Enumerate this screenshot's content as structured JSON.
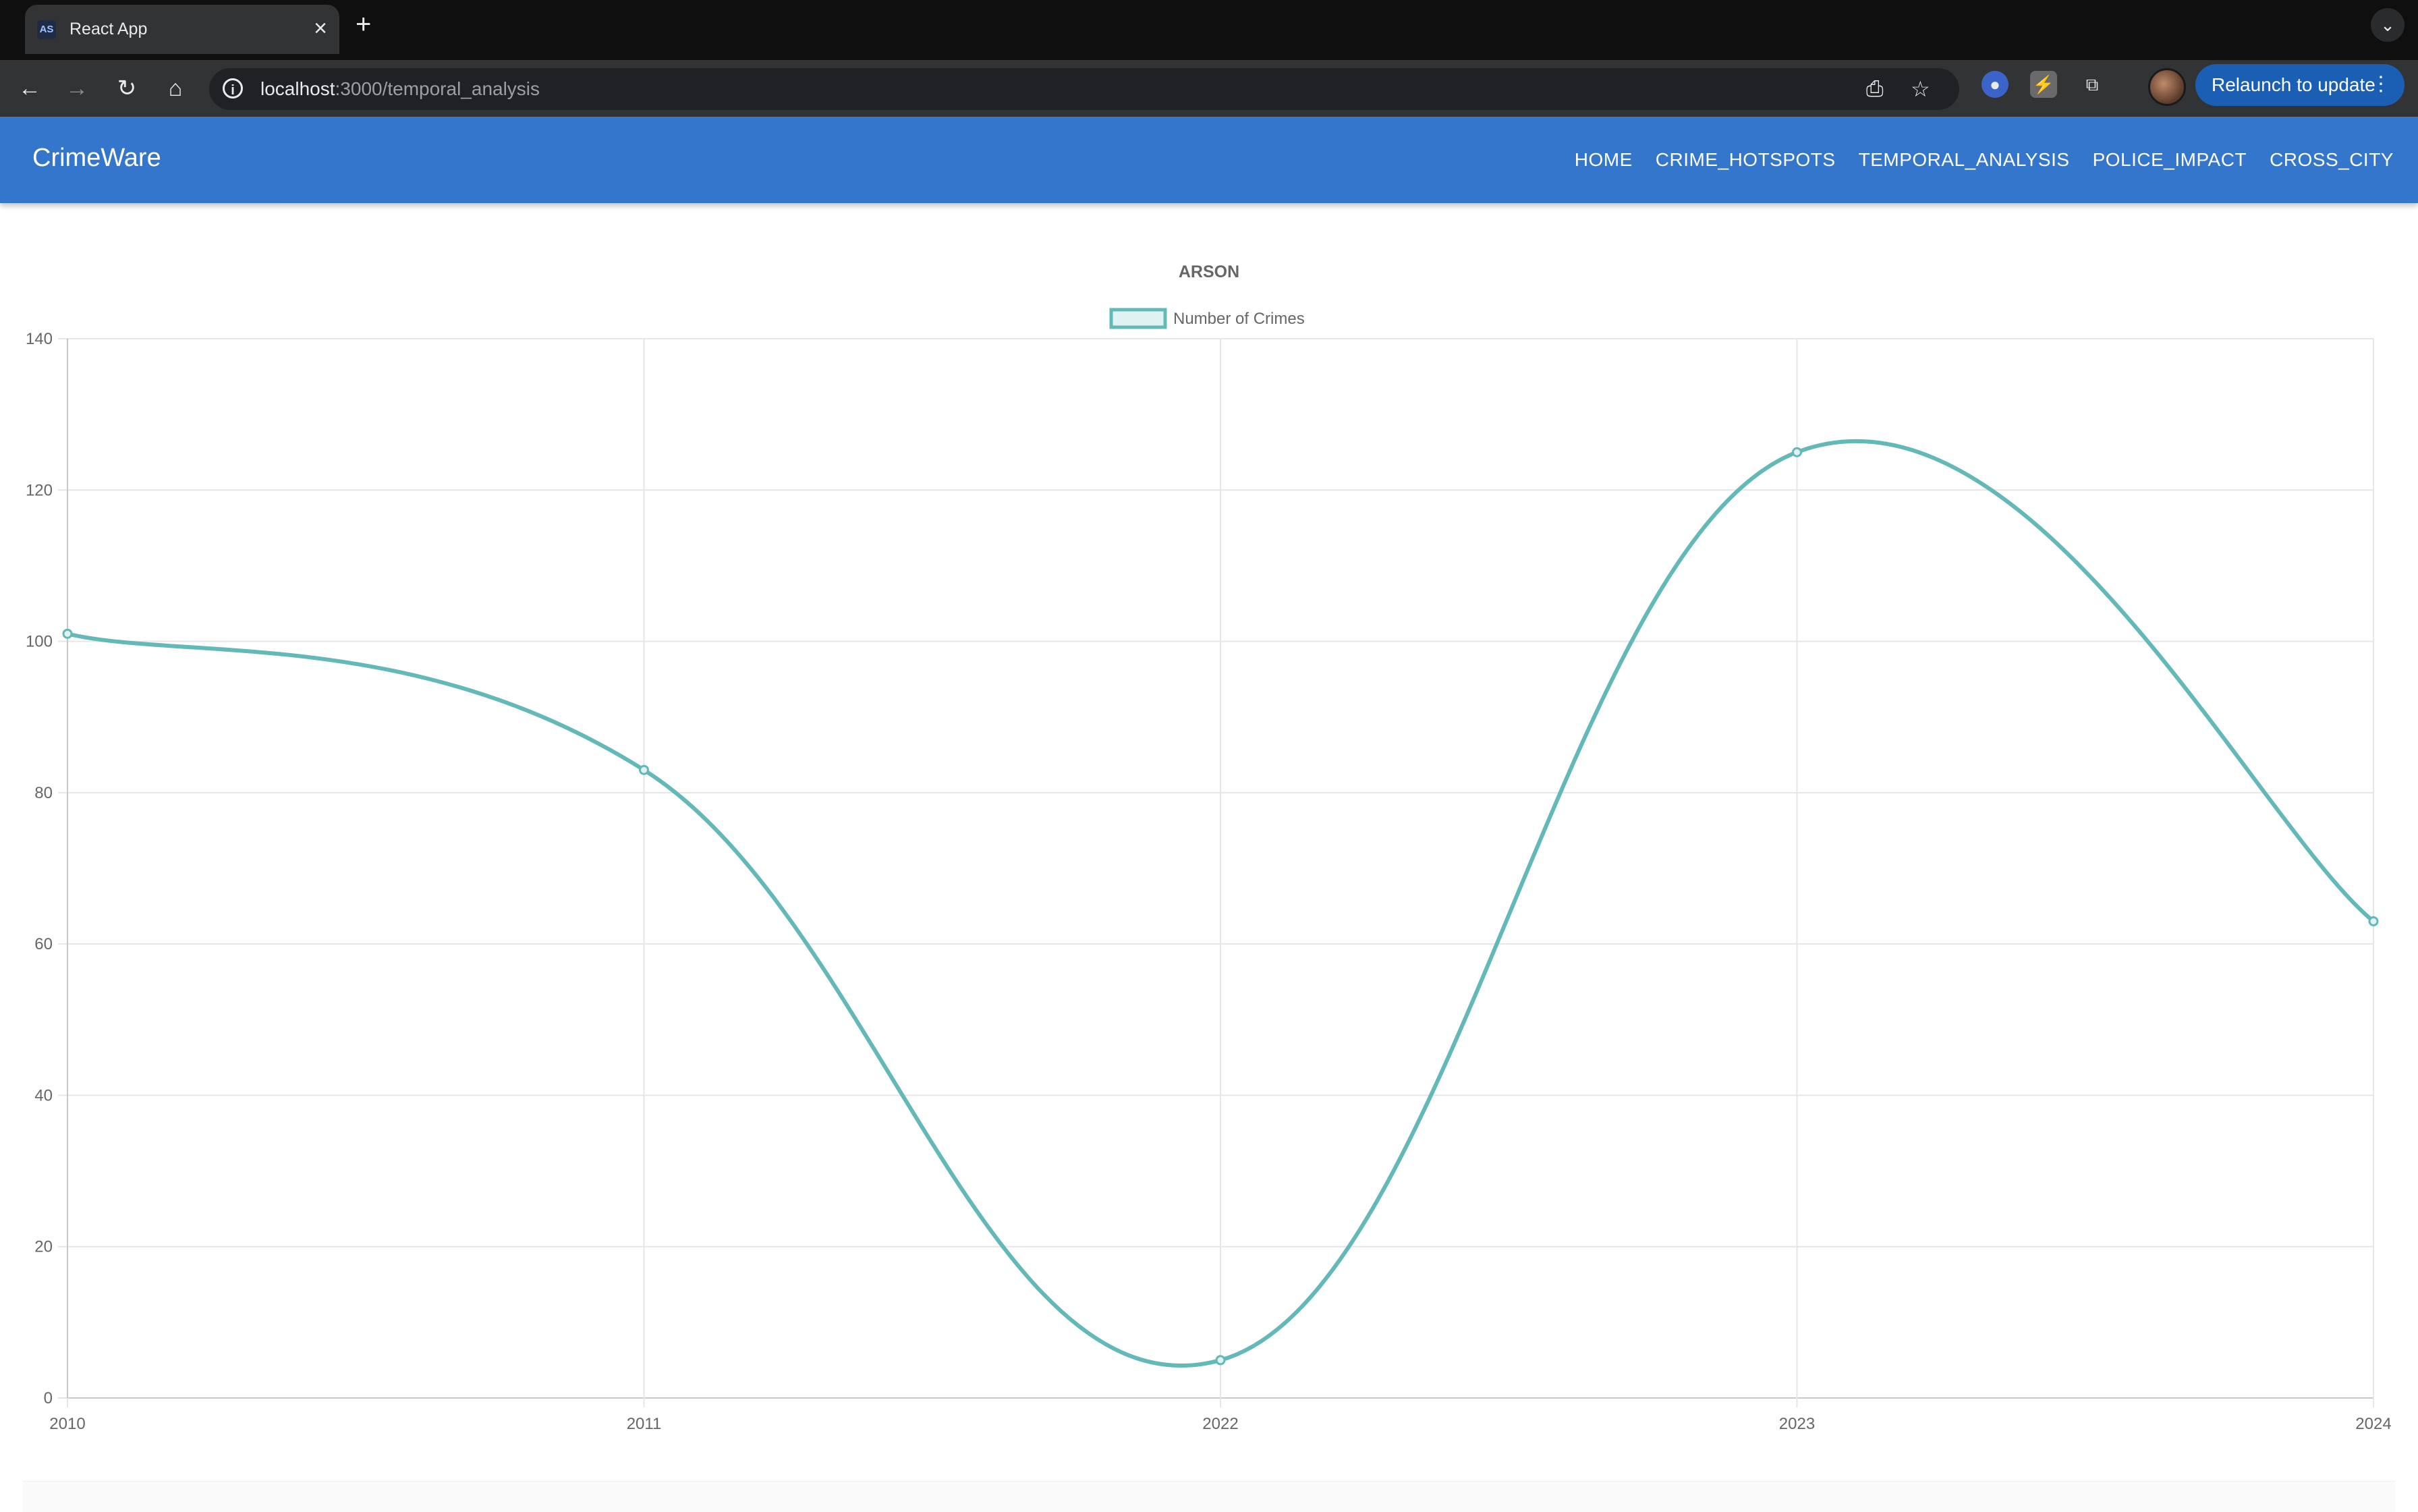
{
  "browser": {
    "tab_title": "React App",
    "favicon_text": "AS",
    "url_host": "localhost",
    "url_path": ":3000/temporal_analysis",
    "relaunch_label": "Relaunch to update"
  },
  "app": {
    "brand": "CrimeWare",
    "nav": [
      "HOME",
      "CRIME_HOTSPOTS",
      "TEMPORAL_ANALYSIS",
      "POLICE_IMPACT",
      "CROSS_CITY"
    ]
  },
  "colors": {
    "app_bar": "#3476cb",
    "line": "#63b8b8",
    "grid": "#e6e6e6"
  },
  "chart_data": {
    "type": "line",
    "title": "ARSON",
    "categories": [
      "2010",
      "2011",
      "2022",
      "2023",
      "2024"
    ],
    "series": [
      {
        "name": "Number of Crimes",
        "values": [
          101,
          83,
          5,
          125,
          63
        ]
      }
    ],
    "ylim": [
      0,
      140
    ],
    "yticks": [
      0,
      20,
      40,
      60,
      80,
      100,
      120,
      140
    ],
    "grid": true,
    "legend": "top-center",
    "curve": "smooth"
  }
}
